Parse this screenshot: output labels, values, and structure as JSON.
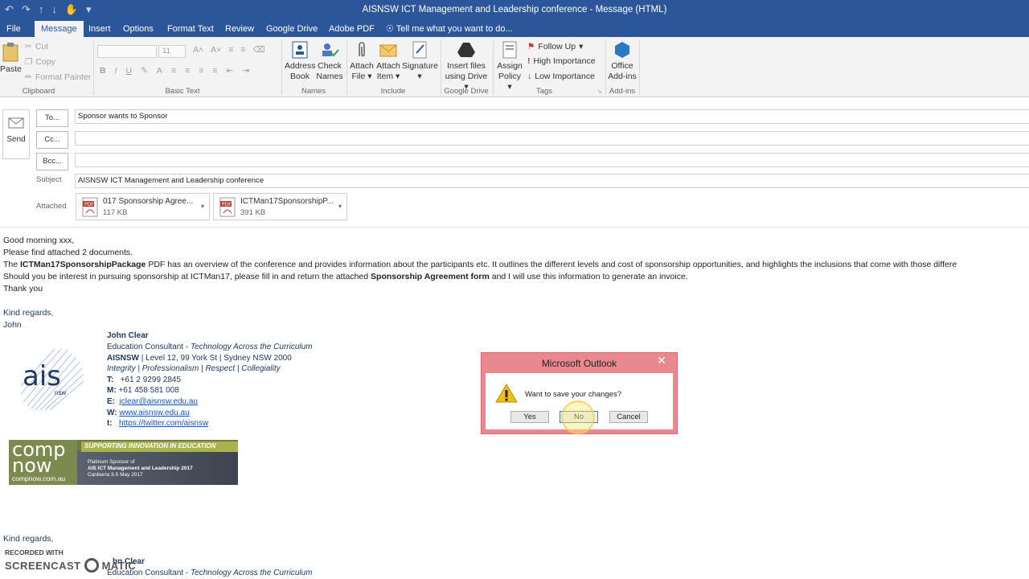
{
  "window": {
    "title": "AISNSW ICT Management and Leadership conference  -  Message (HTML)"
  },
  "tabs": [
    {
      "label": "File"
    },
    {
      "label": "Message"
    },
    {
      "label": "Insert"
    },
    {
      "label": "Options"
    },
    {
      "label": "Format Text"
    },
    {
      "label": "Review"
    },
    {
      "label": "Google Drive"
    },
    {
      "label": "Adobe PDF"
    }
  ],
  "tell_me": "Tell me what you want to do...",
  "ribbon": {
    "clipboard": {
      "paste": "Paste",
      "cut": "Cut",
      "copy": "Copy",
      "format_painter": "Format Painter",
      "label": "Clipboard"
    },
    "basic_text": {
      "font_size": "11",
      "label": "Basic Text"
    },
    "names": {
      "address_book": [
        "Address",
        "Book"
      ],
      "check_names": [
        "Check",
        "Names"
      ],
      "label": "Names"
    },
    "include": {
      "attach_file": [
        "Attach",
        "File"
      ],
      "attach_item": [
        "Attach",
        "Item"
      ],
      "signature": [
        "Signature"
      ],
      "label": "Include"
    },
    "google_drive": {
      "insert": [
        "Insert files",
        "using Drive"
      ],
      "label": "Google Drive"
    },
    "tags": {
      "assign_policy": [
        "Assign",
        "Policy"
      ],
      "follow_up": "Follow Up",
      "high_importance": "High Importance",
      "low_importance": "Low Importance",
      "label": "Tags"
    },
    "addins": {
      "office_addins": [
        "Office",
        "Add-ins"
      ],
      "label": "Add-ins"
    }
  },
  "compose": {
    "send": "Send",
    "to_btn": "To...",
    "cc_btn": "Cc...",
    "bcc_btn": "Bcc...",
    "to_value": "Sponsor wants to Sponsor",
    "subject_label": "Subject",
    "subject_value": "AISNSW ICT Management and Leadership conference",
    "attached_label": "Attached",
    "attachments": [
      {
        "name": "017 Sponsorship Agree...",
        "size": "117 KB"
      },
      {
        "name": "ICTMan17SponsorshipP...",
        "size": "391 KB"
      }
    ]
  },
  "body": {
    "greeting": "Good morning xxx,",
    "line2": "Please find attached 2 documents.",
    "line3_pre": "The ",
    "line3_bold": "ICTMan17SponsorshipPackage",
    "line3_post": " PDF has an overview of the conference and provides information about the participants etc. It outlines the different levels and cost of sponsorship opportunities, and highlights the inclusions that come with those differe",
    "line4_pre": "Should you be interest in pursuing sponsorship at ICTMan17, please fill in and return the attached ",
    "line4_bold": "Sponsorship Agreement form",
    "line4_post": " and I will use this information to generate an invoice.",
    "thanks": "Thank you",
    "regards": "Kind regards,",
    "sign_name": "John",
    "regards2": "Kind regards,"
  },
  "signature": {
    "name": "John Clear",
    "role_pre": "Education Consultant - ",
    "role_it": "Technology Across the Curriculum",
    "org_bold": "AISNSW",
    "org_rest": " | Level 12, 99 York St  | Sydney NSW 2000",
    "values": "Integrity | Professionalism | Respect | Collegiality",
    "tel_label": "T:",
    "tel": "+61 2 9299 2845",
    "mob_label": "M:",
    "mob": "+61 458 581 008",
    "email_label": "E:",
    "email": "jclear@aisnsw.edu.au",
    "web_label": "W:",
    "web": "www.aisnsw.edu.au",
    "tw_label": "t:",
    "twitter": "https://twitter.com/aisnsw",
    "logo_main": "ais",
    "logo_sub": "nsw"
  },
  "banner": {
    "brand_top": "comp",
    "brand_bottom": "now",
    "url": "compnow.com.au",
    "tagline": "SUPPORTING INNOVATION IN EDUCATION",
    "sponsor_line1": "Platinum Sponsor of",
    "sponsor_line2": "AIS ICT Management and Leadership 2017",
    "sponsor_line3": "Canberra 3-5 May 2017"
  },
  "signature2": {
    "name_partial": "hn Clear",
    "role_pre": "Education Consultant - ",
    "role_it": "Technology Across the Curriculum"
  },
  "dialog": {
    "title": "Microsoft Outlook",
    "message": "Want to save your changes?",
    "yes": "Yes",
    "no": "No",
    "cancel": "Cancel"
  },
  "watermark": {
    "line1": "RECORDED WITH",
    "line2_a": "SCREENCAST",
    "line2_b": "MATIC"
  },
  "colors": {
    "accent": "#2b579a",
    "dialog_frame": "#e9888f"
  }
}
